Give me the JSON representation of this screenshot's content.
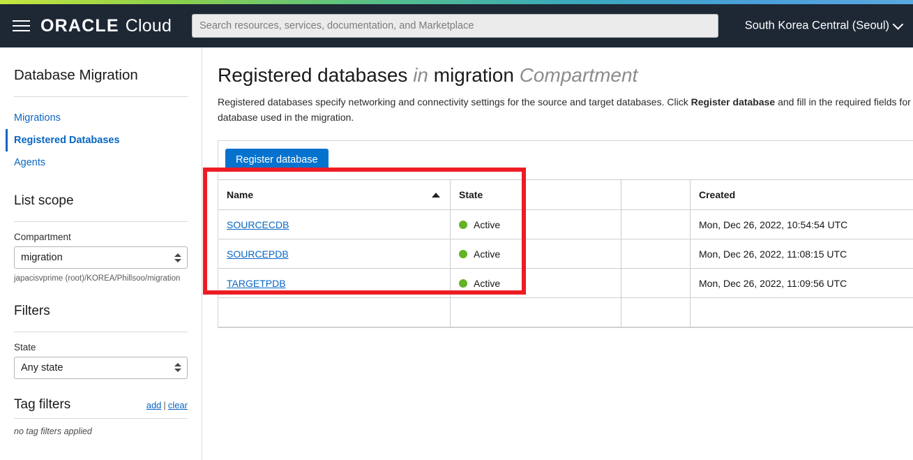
{
  "header": {
    "menu_icon": "hamburger-icon",
    "brand_oracle": "ORACLE",
    "brand_cloud": "Cloud",
    "search_placeholder": "Search resources, services, documentation, and Marketplace",
    "search_value": "",
    "region": "South Korea Central (Seoul)",
    "region_chevron_icon": "chevron-down-icon"
  },
  "sidebar": {
    "service_title": "Database Migration",
    "nav": [
      {
        "label": "Migrations",
        "active": false
      },
      {
        "label": "Registered Databases",
        "active": true
      },
      {
        "label": "Agents",
        "active": false
      }
    ],
    "list_scope_title": "List scope",
    "compartment_label": "Compartment",
    "compartment_value": "migration",
    "compartment_path": "japacisvprime (root)/KOREA/Phillsoo/migration",
    "filters_title": "Filters",
    "state_label": "State",
    "state_value": "Any state",
    "tag_filters_title": "Tag filters",
    "tag_add": "add",
    "tag_sep": "|",
    "tag_clear": "clear",
    "no_tag_filters": "no tag filters applied"
  },
  "main": {
    "title_part1": "Registered databases ",
    "title_part2": "in",
    "title_part3": " migration ",
    "title_part4": "Compartment",
    "description_pre": "Registered databases specify networking and connectivity settings for the source and target databases. Click ",
    "description_bold": "Register database",
    "description_post": " and fill in the required fields for each database used in the migration.",
    "register_button": "Register database",
    "table": {
      "columns": [
        "Name",
        "State",
        "",
        "Created"
      ],
      "sort_column": "Name",
      "sort_direction": "ascending",
      "rows": [
        {
          "name": "SOURCECDB",
          "state": "Active",
          "blank": "",
          "created": "Mon, Dec 26, 2022, 10:54:54 UTC"
        },
        {
          "name": "SOURCEPDB",
          "state": "Active",
          "blank": "",
          "created": "Mon, Dec 26, 2022, 11:08:15 UTC"
        },
        {
          "name": "TARGETPDB",
          "state": "Active",
          "blank": "",
          "created": "Mon, Dec 26, 2022, 11:09:56 UTC"
        }
      ]
    }
  },
  "colors": {
    "accent_blue": "#0572ce",
    "link_blue": "#0a66c2",
    "status_green": "#63b324",
    "annotation_red": "#ed1c24",
    "header_dark": "#1e2835"
  }
}
